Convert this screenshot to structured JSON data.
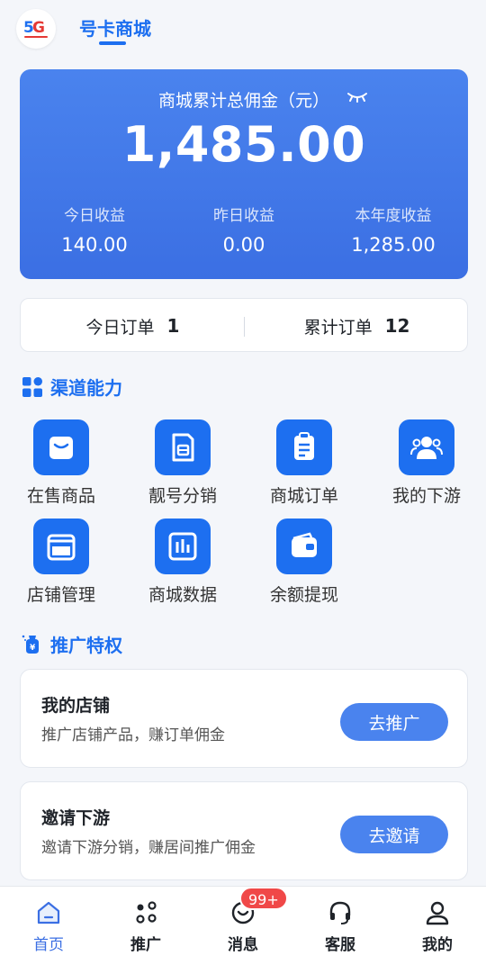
{
  "header": {
    "logo_text": "5G",
    "title": "号卡商城"
  },
  "hero": {
    "title": "商城累计总佣金（元）",
    "total": "1,485.00",
    "stats": [
      {
        "label": "今日收益",
        "value": "140.00"
      },
      {
        "label": "昨日收益",
        "value": "0.00"
      },
      {
        "label": "本年度收益",
        "value": "1,285.00"
      }
    ]
  },
  "orders": {
    "today_label": "今日订单",
    "today_value": "1",
    "total_label": "累计订单",
    "total_value": "12"
  },
  "channel": {
    "title": "渠道能力",
    "items": [
      {
        "label": "在售商品",
        "icon": "shopping-bag-icon"
      },
      {
        "label": "靓号分销",
        "icon": "sim-card-icon"
      },
      {
        "label": "商城订单",
        "icon": "clipboard-icon"
      },
      {
        "label": "我的下游",
        "icon": "users-icon"
      },
      {
        "label": "店铺管理",
        "icon": "storefront-icon"
      },
      {
        "label": "商城数据",
        "icon": "bar-chart-icon"
      },
      {
        "label": "余额提现",
        "icon": "wallet-icon"
      }
    ]
  },
  "promo": {
    "title": "推广特权",
    "cards": [
      {
        "title": "我的店铺",
        "desc": "推广店铺产品，赚订单佣金",
        "button": "去推广"
      },
      {
        "title": "邀请下游",
        "desc": "邀请下游分销，赚居间推广佣金",
        "button": "去邀请"
      }
    ]
  },
  "tabbar": {
    "items": [
      {
        "label": "首页",
        "icon": "home-icon",
        "active": true
      },
      {
        "label": "推广",
        "icon": "share-icon"
      },
      {
        "label": "消息",
        "icon": "message-icon"
      },
      {
        "label": "客服",
        "icon": "headset-icon"
      },
      {
        "label": "我的",
        "icon": "user-icon"
      }
    ],
    "message_badge": "99+"
  },
  "colors": {
    "primary": "#1d6ff0",
    "hero_gradient_start": "#4a83ee",
    "hero_gradient_end": "#3b6fe3",
    "badge": "#f04848"
  }
}
